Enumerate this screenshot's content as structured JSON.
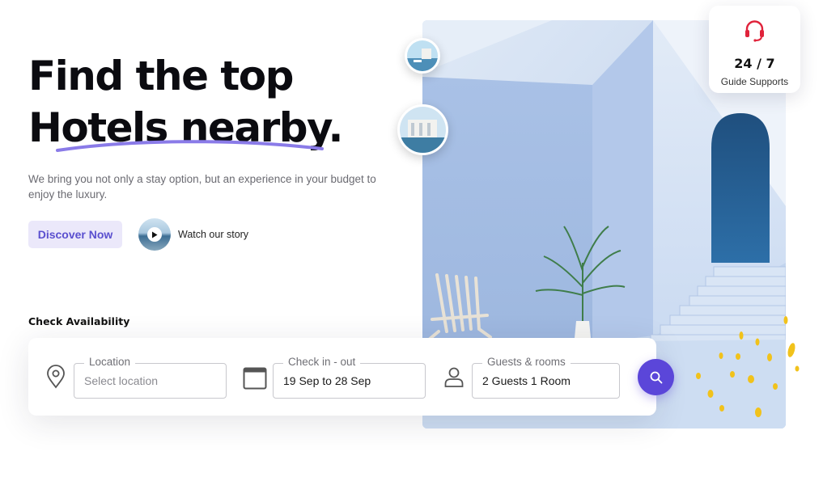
{
  "hero": {
    "headline_line1": "Find the top",
    "headline_line2": "Hotels nearby.",
    "subtitle": "We bring you not only a stay option, but an experience in your budget to enjoy the luxury.",
    "discover_label": "Discover Now",
    "watch_label": "Watch our story"
  },
  "support": {
    "number": "24 / 7",
    "label": "Guide Supports",
    "icon": "headset-icon"
  },
  "availability": {
    "title": "Check Availability",
    "location": {
      "legend": "Location",
      "placeholder": "Select location",
      "value": "",
      "icon": "map-pin-icon"
    },
    "dates": {
      "legend": "Check in - out",
      "value": "19 Sep to 28 Sep",
      "icon": "calendar-icon"
    },
    "guests": {
      "legend": "Guests & rooms",
      "value": "2 Guests 1 Room",
      "icon": "user-icon"
    },
    "search_icon": "search-icon"
  },
  "colors": {
    "accent": "#5b46d9",
    "accent_soft": "#ebe8fa",
    "support_icon": "#e0233b",
    "petals": "#f1c21b"
  }
}
